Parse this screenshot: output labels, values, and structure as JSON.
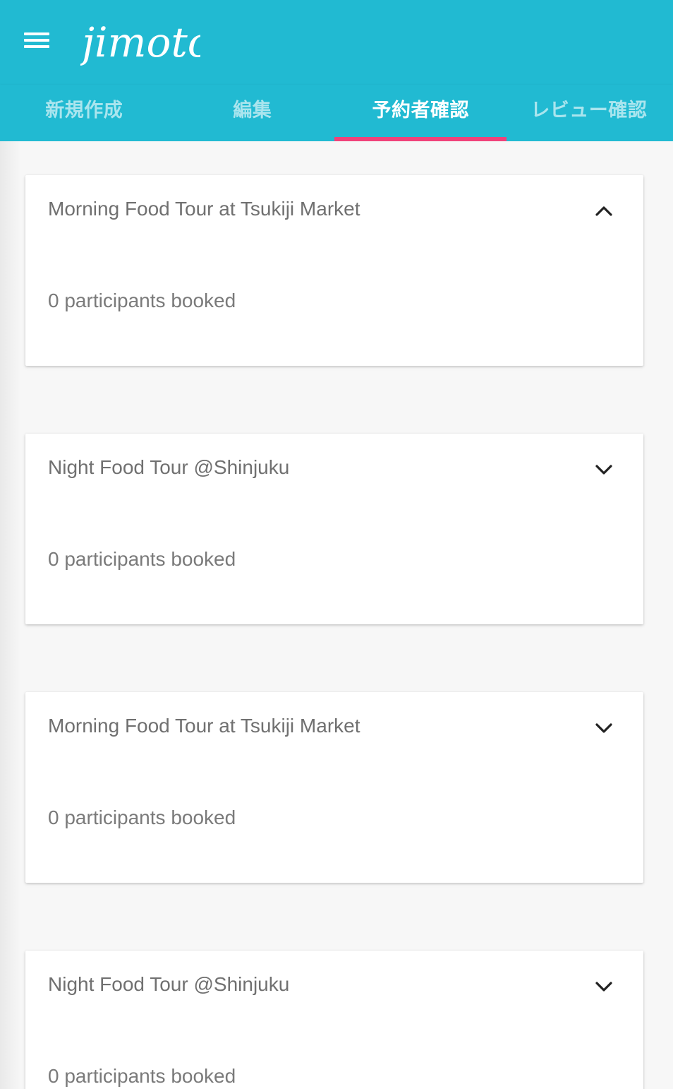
{
  "app": {
    "logo_text": "jimoto",
    "menu_icon": "hamburger-menu-icon"
  },
  "colors": {
    "primary": "#21bad2",
    "tab_indicator": "#f0427a",
    "card_text": "#707070"
  },
  "tabs": [
    {
      "label": "新規作成",
      "active": false
    },
    {
      "label": "編集",
      "active": false
    },
    {
      "label": "予約者確認",
      "active": true
    },
    {
      "label": "レビュー確認",
      "active": false
    }
  ],
  "cards": [
    {
      "title": "Morning Food Tour at Tsukiji Market",
      "count_text": "0 participants booked",
      "expanded": true,
      "toggle_icon": "chevron-up-icon"
    },
    {
      "title": "Night Food Tour @Shinjuku",
      "count_text": "0 participants booked",
      "expanded": false,
      "toggle_icon": "chevron-down-icon"
    },
    {
      "title": "Morning Food Tour at Tsukiji Market",
      "count_text": "0 participants booked",
      "expanded": false,
      "toggle_icon": "chevron-down-icon"
    },
    {
      "title": "Night Food Tour @Shinjuku",
      "count_text": "0 participants booked",
      "expanded": false,
      "toggle_icon": "chevron-down-icon"
    }
  ]
}
